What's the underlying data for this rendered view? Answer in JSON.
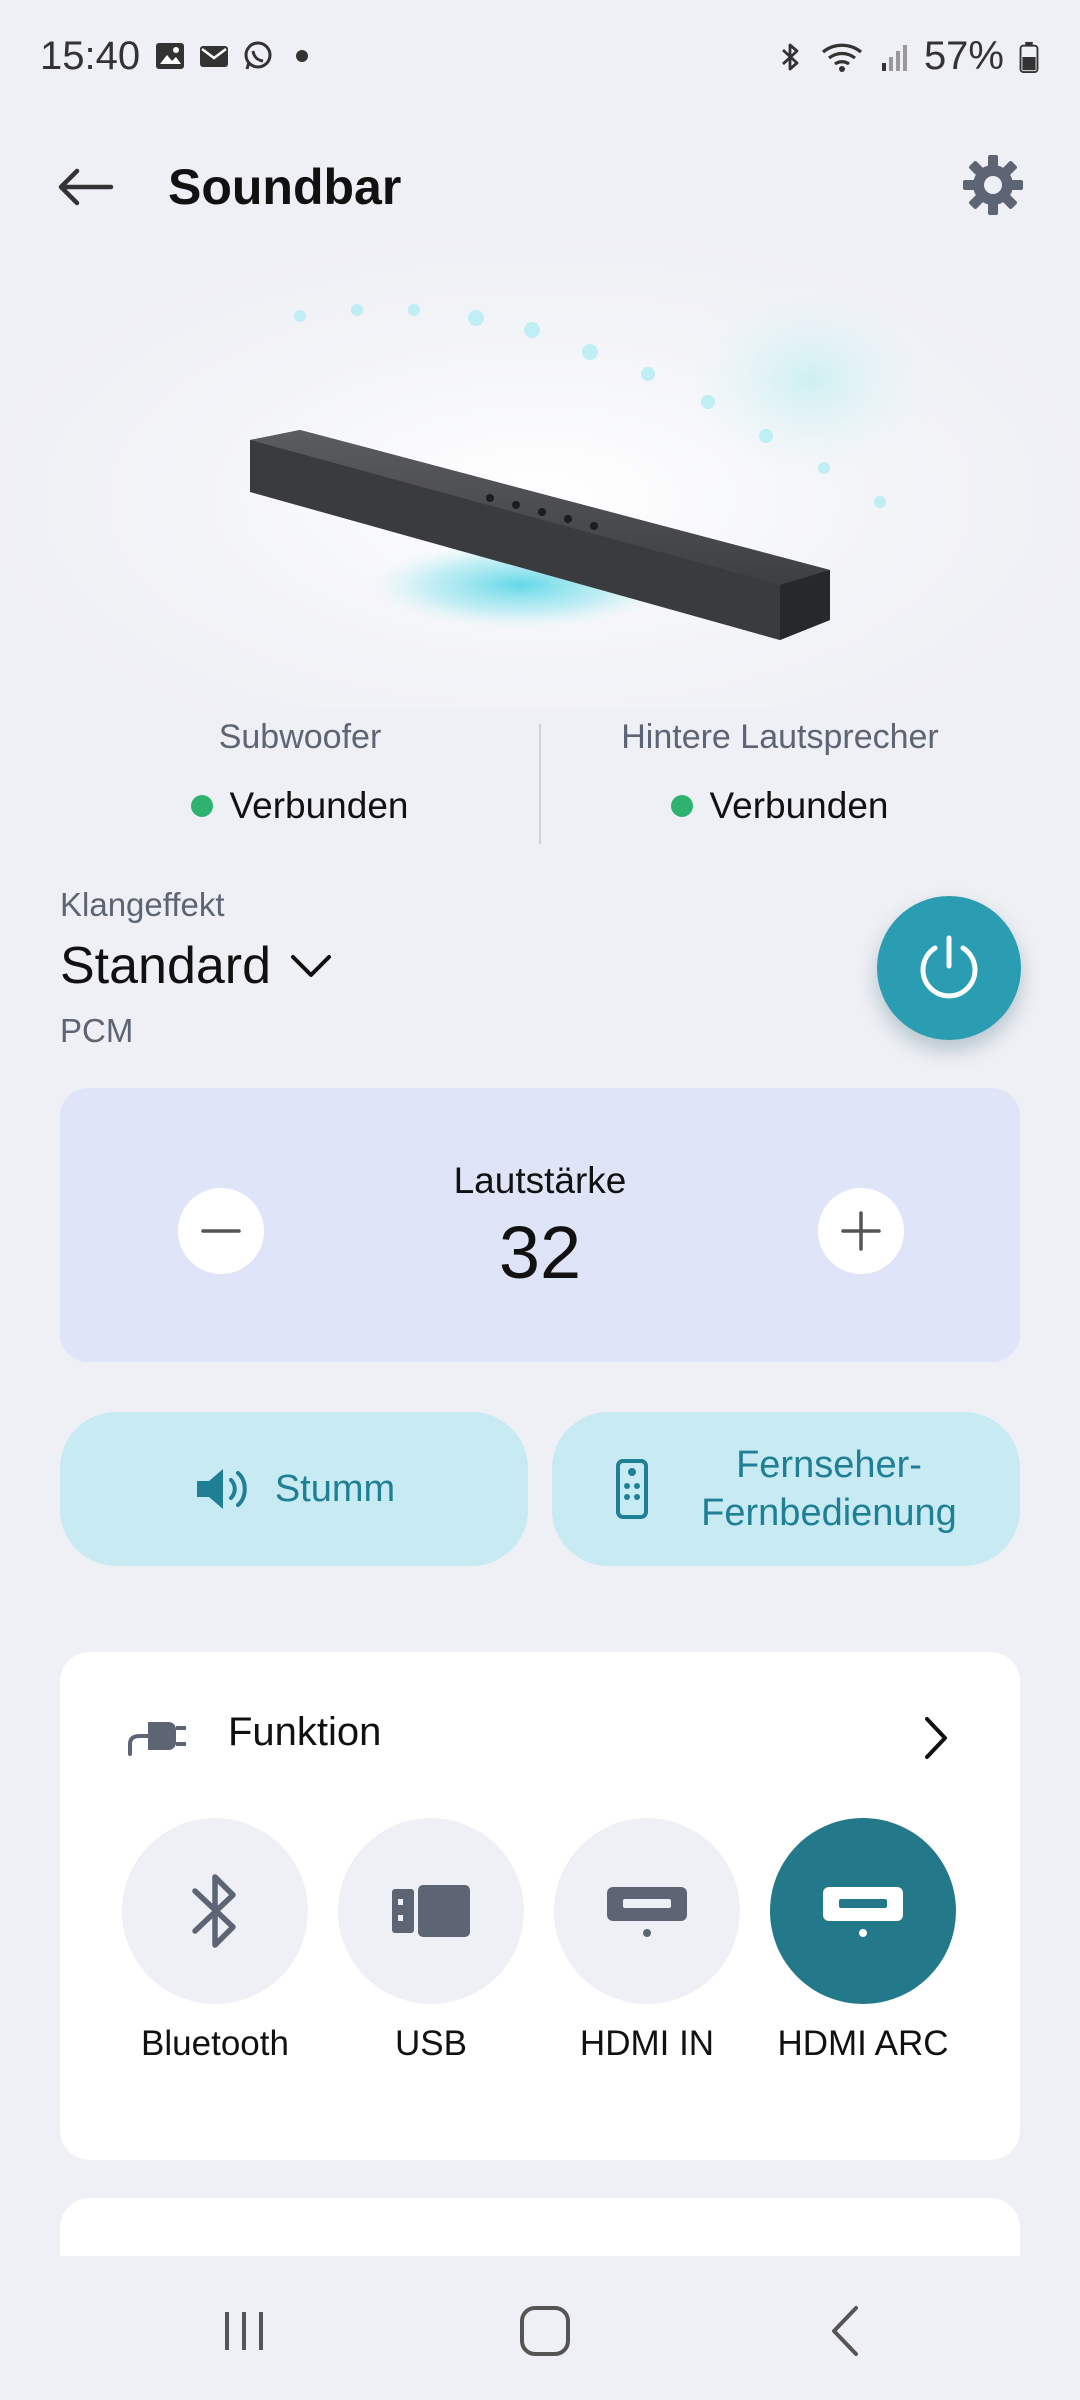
{
  "status_bar": {
    "time": "15:40",
    "left_icons": [
      "image-icon",
      "mail-icon",
      "whatsapp-icon",
      "dot-icon"
    ],
    "right_icons": [
      "bluetooth-icon",
      "wifi-icon",
      "signal-icon",
      "battery-icon"
    ],
    "battery": "57%"
  },
  "header": {
    "title": "Soundbar",
    "back_icon": "arrow-left-icon",
    "settings_icon": "gear-icon"
  },
  "speakers": {
    "left": {
      "name": "Subwoofer",
      "state": "Verbunden"
    },
    "right": {
      "name": "Hintere Lautsprecher",
      "state": "Verbunden"
    },
    "status_color": "#2db36f"
  },
  "sound_effect": {
    "label": "Klangeffekt",
    "value": "Standard",
    "format": "PCM"
  },
  "volume": {
    "label": "Lautstärke",
    "value": "32"
  },
  "actions": {
    "mute": "Stumm",
    "remote_line1": "Fernseher-",
    "remote_line2": "Fernbedienung"
  },
  "function": {
    "title": "Funktion",
    "sources": [
      {
        "label": "Bluetooth",
        "icon": "bluetooth-icon",
        "active": false
      },
      {
        "label": "USB",
        "icon": "usb-icon",
        "active": false
      },
      {
        "label": "HDMI IN",
        "icon": "hdmi-in-icon",
        "active": false
      },
      {
        "label": "HDMI ARC",
        "icon": "hdmi-arc-icon",
        "active": true
      }
    ]
  },
  "colors": {
    "accent": "#2a9db2",
    "active_source": "#23788a",
    "volume_card": "#e0e4f9",
    "pill": "#c8eaf3",
    "background": "#eff0f5"
  }
}
